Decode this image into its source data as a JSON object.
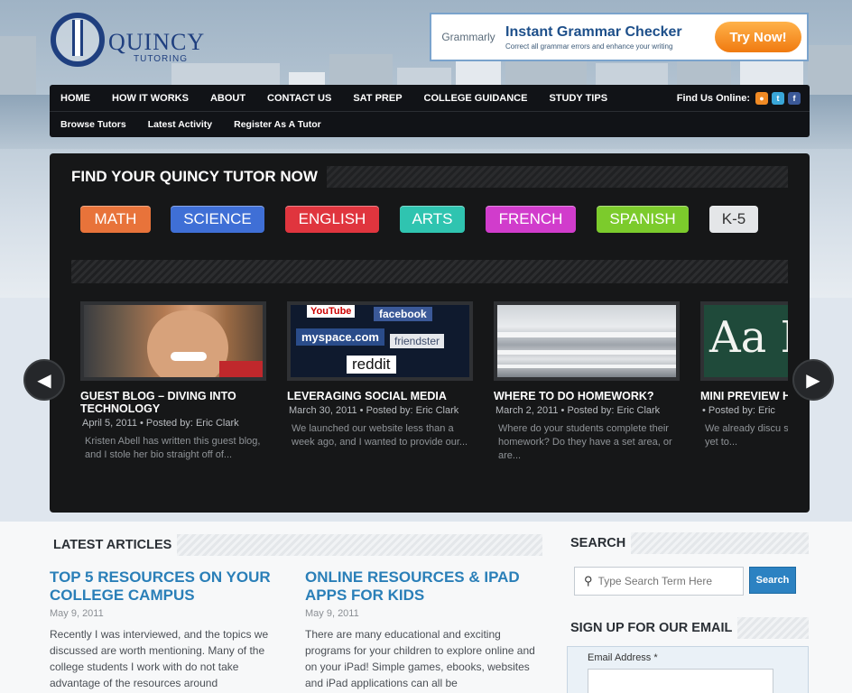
{
  "logo": {
    "name": "QUINCY",
    "sub": "TUTORING"
  },
  "ad": {
    "brand": "Grammarly",
    "title": "Instant Grammar Checker",
    "subtitle": "Correct all grammar errors and enhance your writing",
    "cta": "Try Now!"
  },
  "nav": {
    "primary": [
      "HOME",
      "HOW IT WORKS",
      "ABOUT",
      "CONTACT US",
      "SAT PREP",
      "COLLEGE GUIDANCE",
      "STUDY TIPS"
    ],
    "find_label": "Find Us Online:",
    "social": [
      {
        "icon": "rss-icon",
        "glyph": "●",
        "color": "#f08a24"
      },
      {
        "icon": "twitter-icon",
        "glyph": "t",
        "color": "#39a6d8"
      },
      {
        "icon": "facebook-icon",
        "glyph": "f",
        "color": "#3b5998"
      }
    ],
    "secondary": [
      "Browse Tutors",
      "Latest Activity",
      "Register As A Tutor"
    ]
  },
  "finder": {
    "title": "FIND YOUR QUINCY TUTOR NOW",
    "subjects": [
      {
        "label": "MATH",
        "color": "#e8733a"
      },
      {
        "label": "SCIENCE",
        "color": "#3f6fd6"
      },
      {
        "label": "ENGLISH",
        "color": "#e0353e"
      },
      {
        "label": "ARTS",
        "color": "#2fc4b0"
      },
      {
        "label": "FRENCH",
        "color": "#d13ccc"
      },
      {
        "label": "SPANISH",
        "color": "#7ccb2c"
      },
      {
        "label": "K-5",
        "color": "#e4e6e8"
      }
    ]
  },
  "posts": [
    {
      "title": "GUEST BLOG – DIVING INTO TECHNOLOGY",
      "meta": "April 5, 2011 • Posted by: Eric Clark",
      "excerpt": "Kristen Abell has written this guest blog, and I stole her bio straight off of..."
    },
    {
      "title": "LEVERAGING SOCIAL MEDIA",
      "meta": "March 30, 2011 • Posted by: Eric Clark",
      "excerpt": "We launched our website less than a week ago, and I wanted to provide our...",
      "thumb_words": [
        "YouTube",
        "facebook",
        "myspace.com",
        "friendster",
        "reddit"
      ]
    },
    {
      "title": "WHERE TO DO HOMEWORK?",
      "meta": "March 2, 2011 • Posted by: Eric Clark",
      "excerpt": "Where do your students complete their homework? Do they have a set area, or are..."
    },
    {
      "title": "MINI PREVIEW HOMEWORK T",
      "meta": "• Posted by: Eric",
      "excerpt": "We already discu specified homew have yet to...",
      "thumb_text": "Aa B"
    }
  ],
  "latest": {
    "heading": "LATEST ARTICLES",
    "articles": [
      {
        "title": "TOP 5 RESOURCES ON YOUR COLLEGE CAMPUS",
        "date": "May 9, 2011",
        "body": "Recently I was interviewed, and the topics we discussed are worth mentioning. Many of the college students I work with do not take advantage of the resources around"
      },
      {
        "title": "ONLINE RESOURCES & IPAD APPS FOR KIDS",
        "date": "May 9, 2011",
        "body": "There are many educational and exciting programs for your children to explore online and on your iPad! Simple games, ebooks, websites and iPad applications can all be"
      }
    ]
  },
  "sidebar": {
    "search_heading": "SEARCH",
    "search_placeholder": "Type Search Term Here",
    "search_button": "Search",
    "signup_heading": "SIGN UP FOR OUR EMAIL",
    "email_label": "Email Address *"
  }
}
